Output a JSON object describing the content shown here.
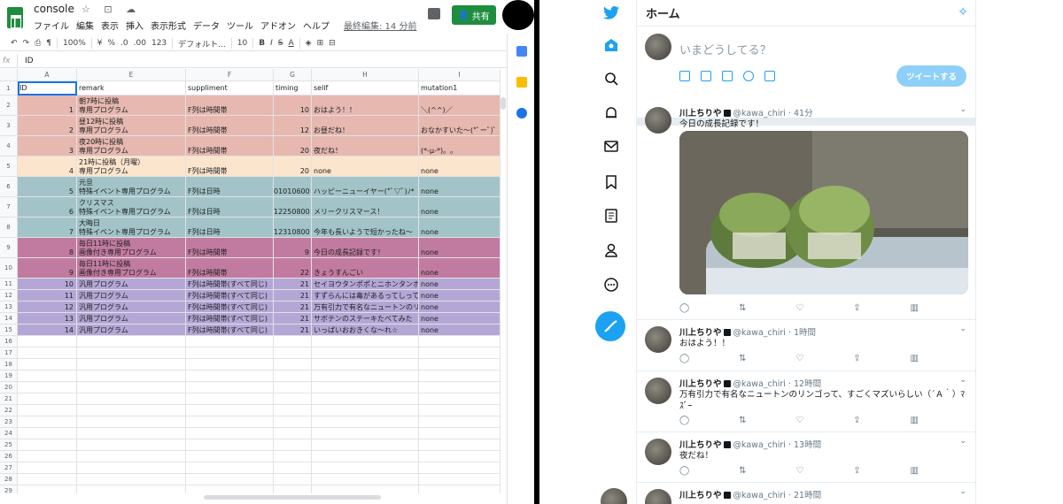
{
  "sheets": {
    "title": "console",
    "title_icons": "☆ ⊡ ☁",
    "menu": [
      "ファイル",
      "編集",
      "表示",
      "挿入",
      "表示形式",
      "データ",
      "ツール",
      "アドオン",
      "ヘルプ"
    ],
    "last_edit": "最終編集: 14 分前",
    "share_label": "共有",
    "toolbar": {
      "zoom": "100%",
      "currency": "¥",
      "percent": "%",
      "dec_less": ".0",
      "dec_more": ".00",
      "format": "123",
      "font": "デフォルト...",
      "size": "10",
      "bold": "B",
      "italic": "I",
      "strike": "S",
      "color": "A"
    },
    "formula_label": "fx",
    "formula_value": "ID",
    "columns": [
      "A",
      "E",
      "F",
      "G",
      "H",
      "I"
    ],
    "header_row": {
      "num": "1",
      "A": "ID",
      "E": "remark",
      "F": "suppliment",
      "G": "timing",
      "H": "selif",
      "I": "mutation1"
    },
    "rows": [
      {
        "num": "2",
        "A": "1",
        "E1": "朝7時に投稿",
        "E2": "専用プログラム",
        "F": "F列は時間帯",
        "G": "10",
        "H": "おはよう！！",
        "I": "＼(^^)／"
      },
      {
        "num": "3",
        "A": "2",
        "E1": "昼12時に投稿",
        "E2": "専用プログラム",
        "F": "F列は時間帯",
        "G": "12",
        "H": "お昼だね！",
        "I": "おなかすいた～(*ﾟーﾟ)ﾟ"
      },
      {
        "num": "4",
        "A": "3",
        "E1": "夜20時に投稿",
        "E2": "専用プログラム",
        "F": "F列は時間帯",
        "G": "20",
        "H": "夜だね！",
        "I": "(*-μ-*)。｡"
      },
      {
        "num": "5",
        "A": "4",
        "E1": "21時に投稿（月曜）",
        "E2": "専用プログラム",
        "F": "F列は時間帯",
        "G": "20",
        "H": "none",
        "I": "none"
      },
      {
        "num": "6",
        "A": "5",
        "E1": "元旦",
        "E2": "特殊イベント専用プログラム",
        "F": "F列は日時",
        "G": "01010600",
        "H": "ハッピーニューイヤー(*ﾟ▽ﾟ)ﾉ*",
        "I": "none"
      },
      {
        "num": "7",
        "A": "6",
        "E1": "クリスマス",
        "E2": "特殊イベント専用プログラム",
        "F": "F列は日時",
        "G": "12250800",
        "H": "メリークリスマース！",
        "I": "none"
      },
      {
        "num": "8",
        "A": "7",
        "E1": "大晦日",
        "E2": "特殊イベント専用プログラム",
        "F": "F列は日時",
        "G": "12310800",
        "H": "今年も長いようで短かったね～",
        "I": "none"
      },
      {
        "num": "9",
        "A": "8",
        "E1": "毎日11時に投稿",
        "E2": "画像付き専用プログラム",
        "F": "F列は時間帯",
        "G": "9",
        "H": "今日の成長記録です！",
        "I": "none"
      },
      {
        "num": "10",
        "A": "9",
        "E1": "毎日11時に投稿",
        "E2": "画像付き専用プログラム",
        "F": "F列は時間帯",
        "G": "22",
        "H": "きょうすんごい",
        "I": "none"
      },
      {
        "num": "11",
        "A": "10",
        "E1": "",
        "E2": "汎用プログラム",
        "F": "F列は時間帯(すべて同じ)",
        "G": "21",
        "H": "セイヨウタンポポとニホンタンポ",
        "I": "none"
      },
      {
        "num": "12",
        "A": "11",
        "E1": "",
        "E2": "汎用プログラム",
        "F": "F列は時間帯(すべて同じ)",
        "G": "21",
        "H": "すずらんには毒があるってしって",
        "I": "none"
      },
      {
        "num": "13",
        "A": "12",
        "E1": "",
        "E2": "汎用プログラム",
        "F": "F列は時間帯(すべて同じ)",
        "G": "21",
        "H": "万有引力で有名なニュートンのリ",
        "I": "none"
      },
      {
        "num": "14",
        "A": "13",
        "E1": "",
        "E2": "汎用プログラム",
        "F": "F列は時間帯(すべて同じ)",
        "G": "21",
        "H": "サボテンのステーキたべてみた",
        "I": "none"
      },
      {
        "num": "15",
        "A": "14",
        "E1": "",
        "E2": "汎用プログラム",
        "F": "F列は時間帯(すべて同じ)",
        "G": "21",
        "H": "いっぱいおおきくな～れ☆",
        "I": "none"
      }
    ],
    "empty_rows": [
      "16",
      "17",
      "18",
      "19",
      "20",
      "21",
      "22",
      "23",
      "24",
      "25",
      "26",
      "27",
      "28",
      "29"
    ],
    "group_colors": {
      "morning": "#e6b8af",
      "monday": "#fce5cd",
      "event": "#a2c4c9",
      "image": "#c27ba0",
      "generic": "#b4a7d6"
    }
  },
  "twitter": {
    "home_title": "ホーム",
    "compose_placeholder": "いまどうしてる？",
    "tweet_button": "ツイートする",
    "accent": "#1da1f2",
    "tweets": [
      {
        "name": "川上ちりや",
        "handle": "@kawa_chiri",
        "time": "41分",
        "text": "今日の成長記録です！"
      },
      {
        "name": "川上ちりや",
        "handle": "@kawa_chiri",
        "time": "1時間",
        "text": "おはよう！！"
      },
      {
        "name": "川上ちりや",
        "handle": "@kawa_chiri",
        "time": "12時間",
        "text": "万有引力で有名なニュートンのリンゴって、すごくマズいらしい（´Ａ｀）ﾏｽﾞｰ"
      },
      {
        "name": "川上ちりや",
        "handle": "@kawa_chiri",
        "time": "13時間",
        "text": "夜だね！"
      },
      {
        "name": "川上ちりや",
        "handle": "@kawa_chiri",
        "time": "21時間",
        "text": ""
      }
    ]
  }
}
